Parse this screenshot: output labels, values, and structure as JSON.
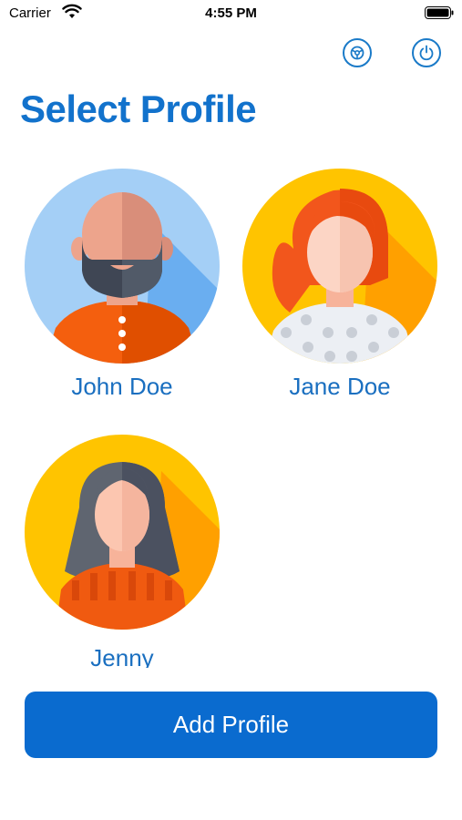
{
  "status_bar": {
    "carrier": "Carrier",
    "time": "4:55 PM",
    "wifi_icon": "wifi-icon",
    "battery_icon": "battery-icon"
  },
  "header": {
    "settings_icon": "settings-icon",
    "power_icon": "power-icon",
    "title": "Select Profile"
  },
  "profiles": [
    {
      "name": "John Doe",
      "avatar": "bald-bearded-man-avatar",
      "bg_color": "#a4cff6"
    },
    {
      "name": "Jane Doe",
      "avatar": "red-haired-woman-avatar",
      "bg_color": "#ffc400"
    },
    {
      "name": "Jenny",
      "avatar": "dark-haired-woman-avatar",
      "bg_color": "#ffc400"
    }
  ],
  "actions": {
    "add_profile_label": "Add Profile"
  },
  "colors": {
    "accent": "#1272cc",
    "button": "#0a6bcf"
  }
}
